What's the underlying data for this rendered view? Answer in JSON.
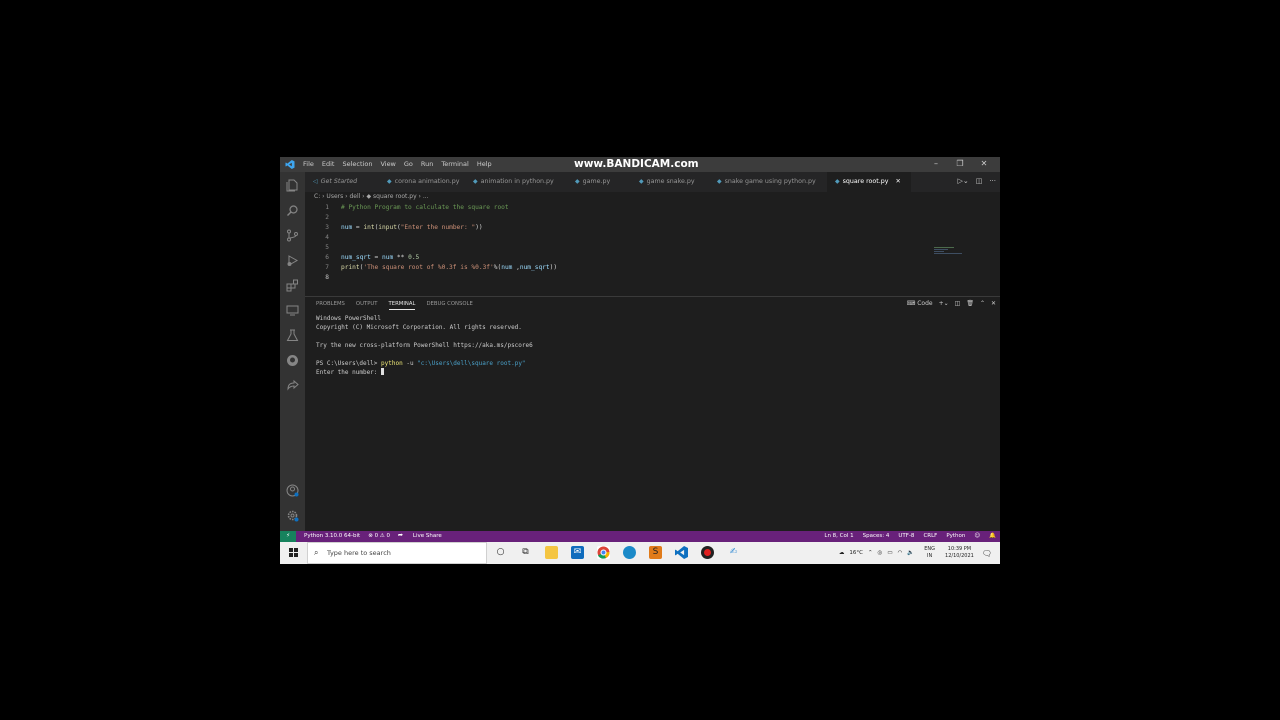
{
  "window": {
    "menu": [
      "File",
      "Edit",
      "Selection",
      "View",
      "Go",
      "Run",
      "Terminal",
      "Help"
    ],
    "watermark": "www.BANDICAM.com",
    "controls": [
      "–",
      "❐",
      "✕"
    ]
  },
  "tabs": [
    {
      "label": "Get Started",
      "italic": true
    },
    {
      "label": "corona animation.py"
    },
    {
      "label": "animation in python.py"
    },
    {
      "label": "game.py"
    },
    {
      "label": "game snake.py"
    },
    {
      "label": "snake game using python.py"
    },
    {
      "label": "square root.py",
      "active": true
    }
  ],
  "tab_close": "✕",
  "breadcrumb": "C: › Users › dell › ◆ square root.py › ...",
  "editor": {
    "line_numbers": [
      "1",
      "2",
      "3",
      "4",
      "5",
      "6",
      "7",
      "8"
    ],
    "lines": [
      "# Python Program to calculate the square root",
      "",
      "num = int(input(\"Enter the number: \"))",
      "",
      "",
      "num_sqrt = num ** 0.5",
      "print('The square root of %0.3f is %0.3f'%(num ,num_sqrt))",
      ""
    ]
  },
  "panel": {
    "tabs": [
      "PROBLEMS",
      "OUTPUT",
      "TERMINAL",
      "DEBUG CONSOLE"
    ],
    "active_tab": "TERMINAL",
    "shell_label": "Code",
    "terminal": {
      "line1": "Windows PowerShell",
      "line2": "Copyright (C) Microsoft Corporation. All rights reserved.",
      "line3": "Try the new cross-platform PowerShell https://aka.ms/pscore6",
      "prompt": "PS C:\\Users\\dell> ",
      "cmd": "python",
      "flag": " -u ",
      "path": "\"c:\\Users\\dell\\square root.py\"",
      "input_prompt": "Enter the number: "
    }
  },
  "statusbar": {
    "remote": "⚡",
    "interpreter": "Python 3.10.0 64-bit",
    "problems": "⊗ 0 ⚠ 0",
    "liveshare": "Live Share",
    "position": "Ln 8, Col 1",
    "spaces": "Spaces: 4",
    "encoding": "UTF-8",
    "eol": "CRLF",
    "language": "Python"
  },
  "taskbar": {
    "search_placeholder": "Type here to search",
    "weather": "16°C",
    "lang": "ENG",
    "region": "IN",
    "time": "10:39 PM",
    "date": "12/10/2021"
  },
  "colors": {
    "statusbar": "#68217a",
    "remote": "#16825d",
    "editor_bg": "#1e1e1e"
  }
}
